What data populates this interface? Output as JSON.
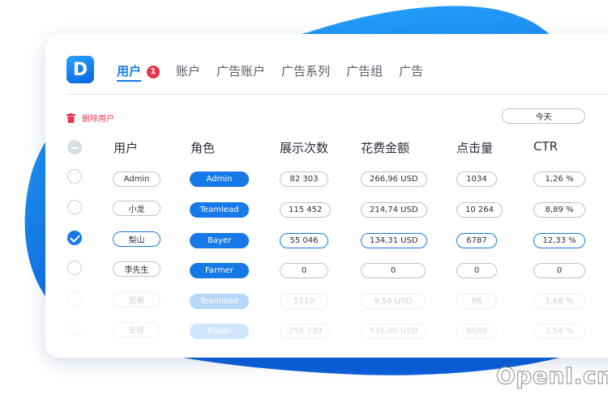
{
  "brand": {
    "logo_letter": "D",
    "accent": "#1779e8",
    "danger": "#e8364d"
  },
  "tabs": [
    {
      "label": "用户",
      "active": true,
      "badge": "1"
    },
    {
      "label": "账户"
    },
    {
      "label": "广告账户"
    },
    {
      "label": "广告系列"
    },
    {
      "label": "广告组"
    },
    {
      "label": "广告"
    }
  ],
  "toolbar": {
    "delete_label": "删除用户",
    "date_value": "今天"
  },
  "table": {
    "headers": [
      "用户",
      "角色",
      "展示次数",
      "花费金额",
      "点击量",
      "CTR"
    ],
    "rows": [
      {
        "user": "Admin",
        "role": "Admin",
        "impressions": "82 303",
        "spend": "266,96 USD",
        "clicks": "1034",
        "ctr": "1,26 %",
        "checked": false
      },
      {
        "user": "小龙",
        "role": "Teamlead",
        "impressions": "115 452",
        "spend": "214,74 USD",
        "clicks": "10 264",
        "ctr": "8,89 %",
        "checked": false
      },
      {
        "user": "梨山",
        "role": "Bayer",
        "impressions": "55 046",
        "spend": "134,31 USD",
        "clicks": "6787",
        "ctr": "12,33 %",
        "checked": true
      },
      {
        "user": "李先生",
        "role": "Farmer",
        "impressions": "0",
        "spend": "0",
        "clicks": "0",
        "ctr": "0",
        "checked": false
      },
      {
        "user": "尼斯",
        "role": "Teamlead",
        "impressions": "5110",
        "spend": "9,50 USD",
        "clicks": "86",
        "ctr": "1,68 %",
        "checked": false
      },
      {
        "user": "安娜",
        "role": "Bayer",
        "impressions": "256 739",
        "spend": "516,00 USD",
        "clicks": "9089",
        "ctr": "3,54 %",
        "checked": false
      }
    ]
  },
  "watermark": "OpenI.cn"
}
